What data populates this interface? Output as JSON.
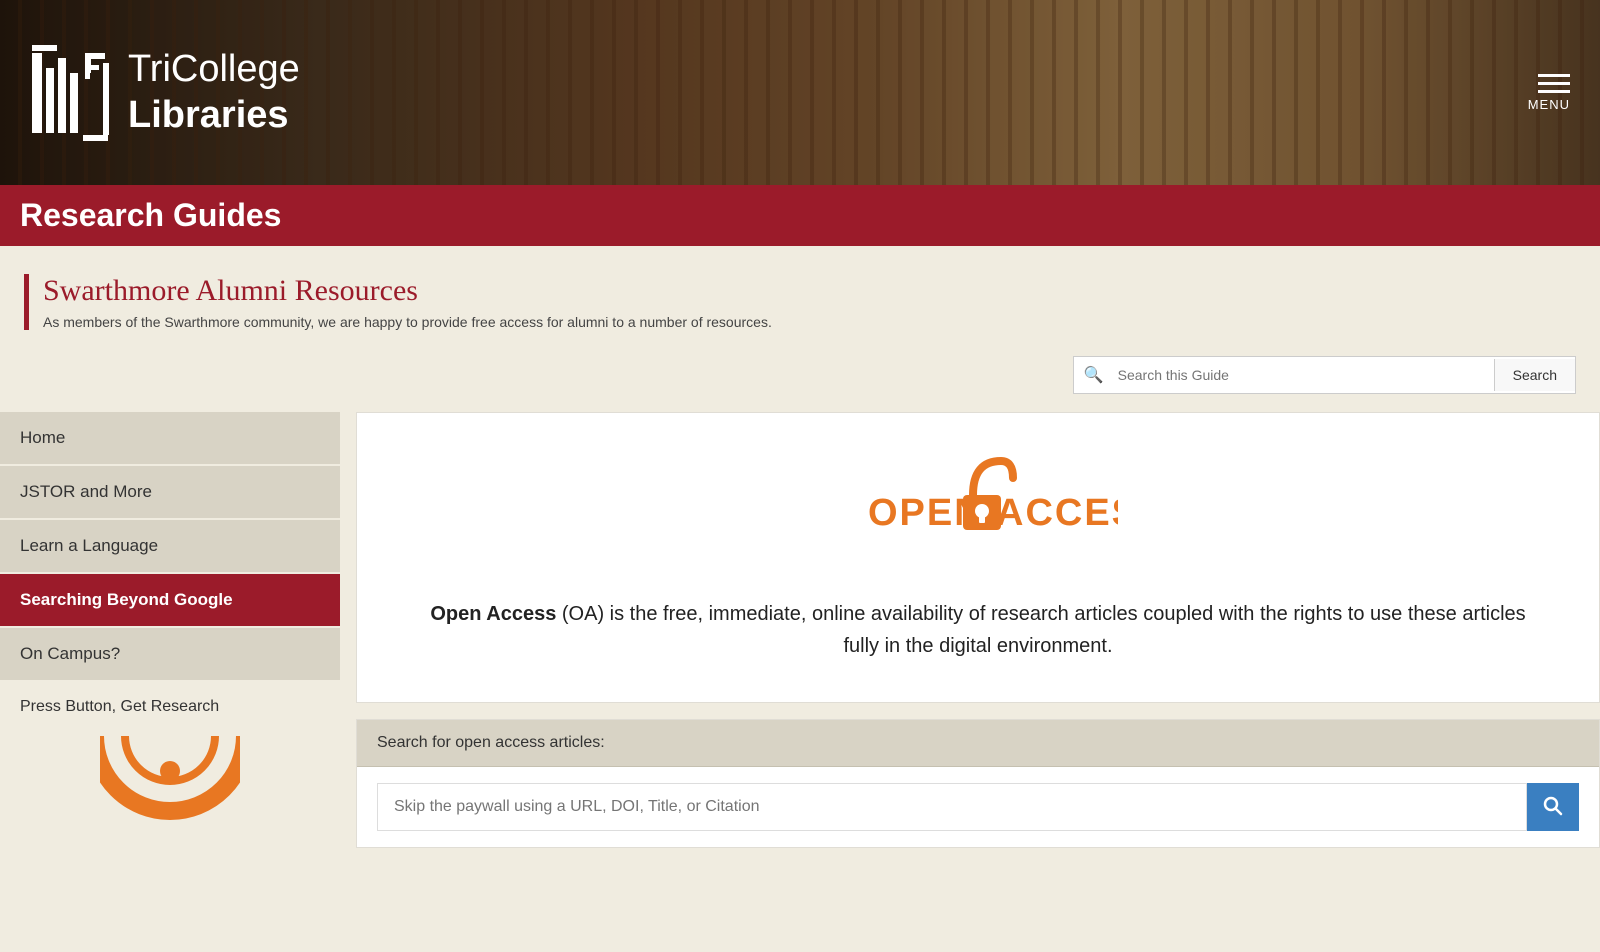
{
  "header": {
    "logo_line1": "TriCollege",
    "logo_line2": "Libraries",
    "menu_label": "MENU"
  },
  "red_bar": {
    "title": "Research Guides"
  },
  "guide": {
    "title": "Swarthmore Alumni Resources",
    "subtitle": "As members of the Swarthmore community, we are happy to provide free access for alumni to a number of resources."
  },
  "search": {
    "placeholder": "Search this Guide",
    "button_label": "Search"
  },
  "sidebar": {
    "nav_items": [
      {
        "label": "Home",
        "active": false
      },
      {
        "label": "JSTOR and More",
        "active": false
      },
      {
        "label": "Learn a Language",
        "active": false
      },
      {
        "label": "Searching Beyond Google",
        "active": true
      },
      {
        "label": "On Campus?",
        "active": false
      }
    ],
    "section_label": "Press Button, Get Research"
  },
  "open_access": {
    "logo_text_left": "OPEN",
    "logo_text_right": "ACCESS",
    "description_bold": "Open Access",
    "description_rest": " (OA) is the free, immediate, online availability of research articles coupled with the rights to use these articles fully in the digital environment.",
    "search_section_header": "Search for open access articles:",
    "search_placeholder": "Skip the paywall using a URL, DOI, Title, or Citation"
  },
  "colors": {
    "red": "#9b1b2a",
    "orange": "#e87722",
    "blue": "#3a7fc1",
    "sidebar_bg": "#d8d3c5",
    "page_bg": "#f0ece0"
  }
}
